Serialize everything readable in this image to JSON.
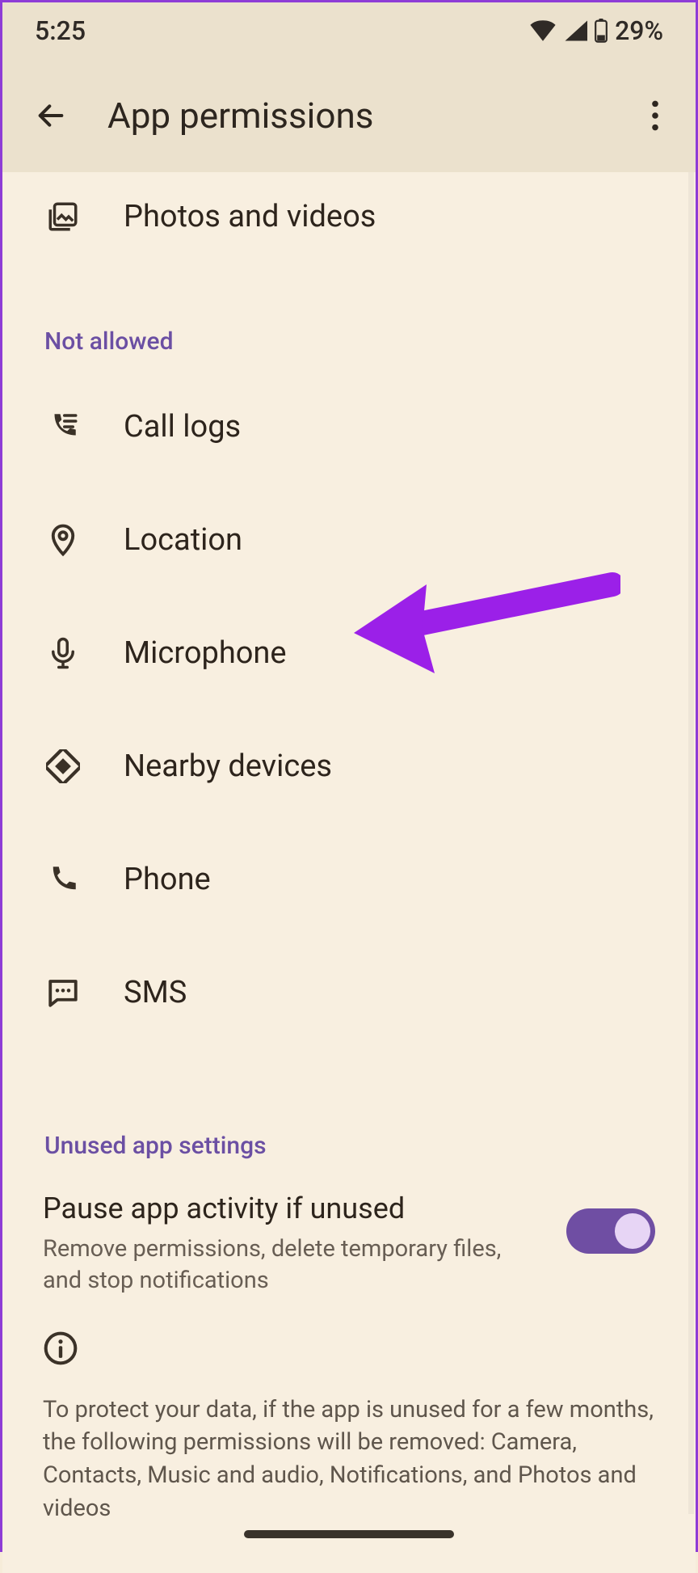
{
  "statusbar": {
    "time": "5:25",
    "battery_pct": "29%"
  },
  "appbar": {
    "title": "App permissions"
  },
  "allowed_tail": {
    "photos_videos": "Photos and videos"
  },
  "sections": {
    "not_allowed": "Not allowed",
    "unused": "Unused app settings"
  },
  "not_allowed_items": {
    "call_logs": "Call logs",
    "location": "Location",
    "microphone": "Microphone",
    "nearby": "Nearby devices",
    "phone": "Phone",
    "sms": "SMS"
  },
  "unused_setting": {
    "title": "Pause app activity if unused",
    "subtitle": "Remove permissions, delete temporary files, and stop notifications",
    "enabled": true
  },
  "info_text": "To protect your data, if the app is unused for a few months, the following permissions will be removed: Camera, Contacts, Music and audio, Notifications, and Photos and videos"
}
